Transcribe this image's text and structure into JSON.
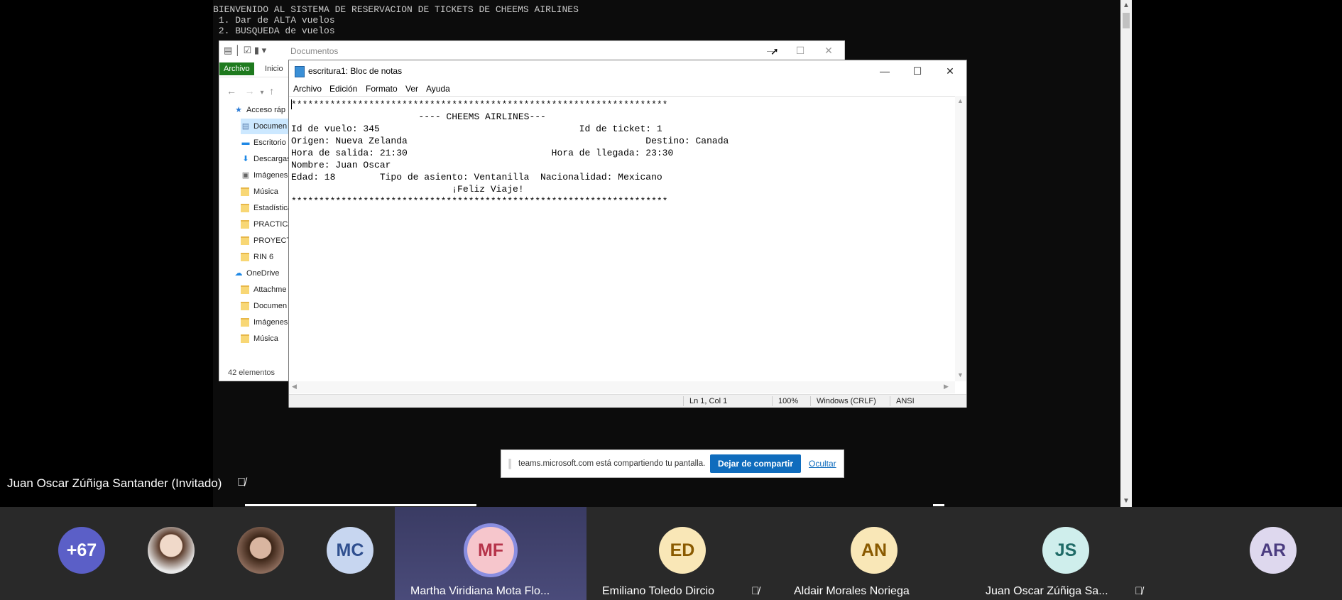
{
  "console": {
    "lines": "BIENVENIDO AL SISTEMA DE RESERVACION DE TICKETS DE CHEEMS AIRLINES\n 1. Dar de ALTA vuelos\n 2. BUSQUEDA de vuelos"
  },
  "explorer": {
    "title": "Documentos",
    "tab_file": "Archivo",
    "tab_home": "Inicio",
    "nav": [
      {
        "label": "Acceso ráp",
        "icon": "star-icon"
      },
      {
        "label": "Documen",
        "icon": "document-icon"
      },
      {
        "label": "Escritorio",
        "icon": "desktop-icon"
      },
      {
        "label": "Descargas",
        "icon": "download-icon"
      },
      {
        "label": "Imágenes",
        "icon": "image-icon"
      },
      {
        "label": "Música",
        "icon": "folder-icon"
      },
      {
        "label": "Estadística",
        "icon": "folder-icon"
      },
      {
        "label": "PRACTICA",
        "icon": "folder-icon"
      },
      {
        "label": "PROYECT",
        "icon": "folder-icon"
      },
      {
        "label": "RIN 6",
        "icon": "folder-icon"
      },
      {
        "label": "OneDrive",
        "icon": "cloud-icon"
      },
      {
        "label": "Attachme",
        "icon": "folder-icon"
      },
      {
        "label": "Documen",
        "icon": "folder-icon"
      },
      {
        "label": "Imágenes",
        "icon": "folder-icon"
      },
      {
        "label": "Música",
        "icon": "folder-icon"
      }
    ],
    "status": "42 elementos"
  },
  "notepad": {
    "title": "escritura1: Bloc de notas",
    "menu": [
      "Archivo",
      "Edición",
      "Formato",
      "Ver",
      "Ayuda"
    ],
    "content": "********************************************************************\n                       ---- CHEEMS AIRLINES---\nId de vuelo: 345                                    Id de ticket: 1\nOrigen: Nueva Zelanda                                           Destino: Canada\nHora de salida: 21:30                          Hora de llegada: 23:30\nNombre: Juan Oscar\nEdad: 18        Tipo de asiento: Ventanilla  Nacionalidad: Mexicano\n                             ¡Feliz Viaje!\n********************************************************************",
    "status": {
      "position": "Ln 1, Col 1",
      "zoom": "100%",
      "line_ending": "Windows (CRLF)",
      "encoding": "ANSI"
    }
  },
  "share_banner": {
    "message": "teams.microsoft.com está compartiendo tu pantalla.",
    "stop_label": "Dejar de compartir",
    "hide_label": "Ocultar"
  },
  "presenter": {
    "name": "Juan Oscar Zúñiga Santander (Invitado)"
  },
  "participants": [
    {
      "initials": "+67",
      "bg": "#5b5fc7",
      "fg": "#ffffff",
      "name": ""
    },
    {
      "initials": "",
      "photo": true,
      "name": ""
    },
    {
      "initials": "",
      "photo": true,
      "name": ""
    },
    {
      "initials": "MC",
      "bg": "#c7d6f0",
      "fg": "#2f4f8f",
      "name": ""
    },
    {
      "initials": "MF",
      "bg": "#f6c6cc",
      "fg": "#b6344a",
      "name": "Martha Viridiana Mota Flo..."
    },
    {
      "initials": "ED",
      "bg": "#f9e7b7",
      "fg": "#8a5a00",
      "name": "Emiliano Toledo Dircio"
    },
    {
      "initials": "AN",
      "bg": "#f9e7b7",
      "fg": "#8a5a00",
      "name": "Aldair Morales Noriega"
    },
    {
      "initials": "JS",
      "bg": "#cfeeec",
      "fg": "#1f6b67",
      "name": "Juan Oscar Zúñiga Sa..."
    },
    {
      "initials": "AR",
      "bg": "#ded8ee",
      "fg": "#4b3c80",
      "name": ""
    }
  ]
}
